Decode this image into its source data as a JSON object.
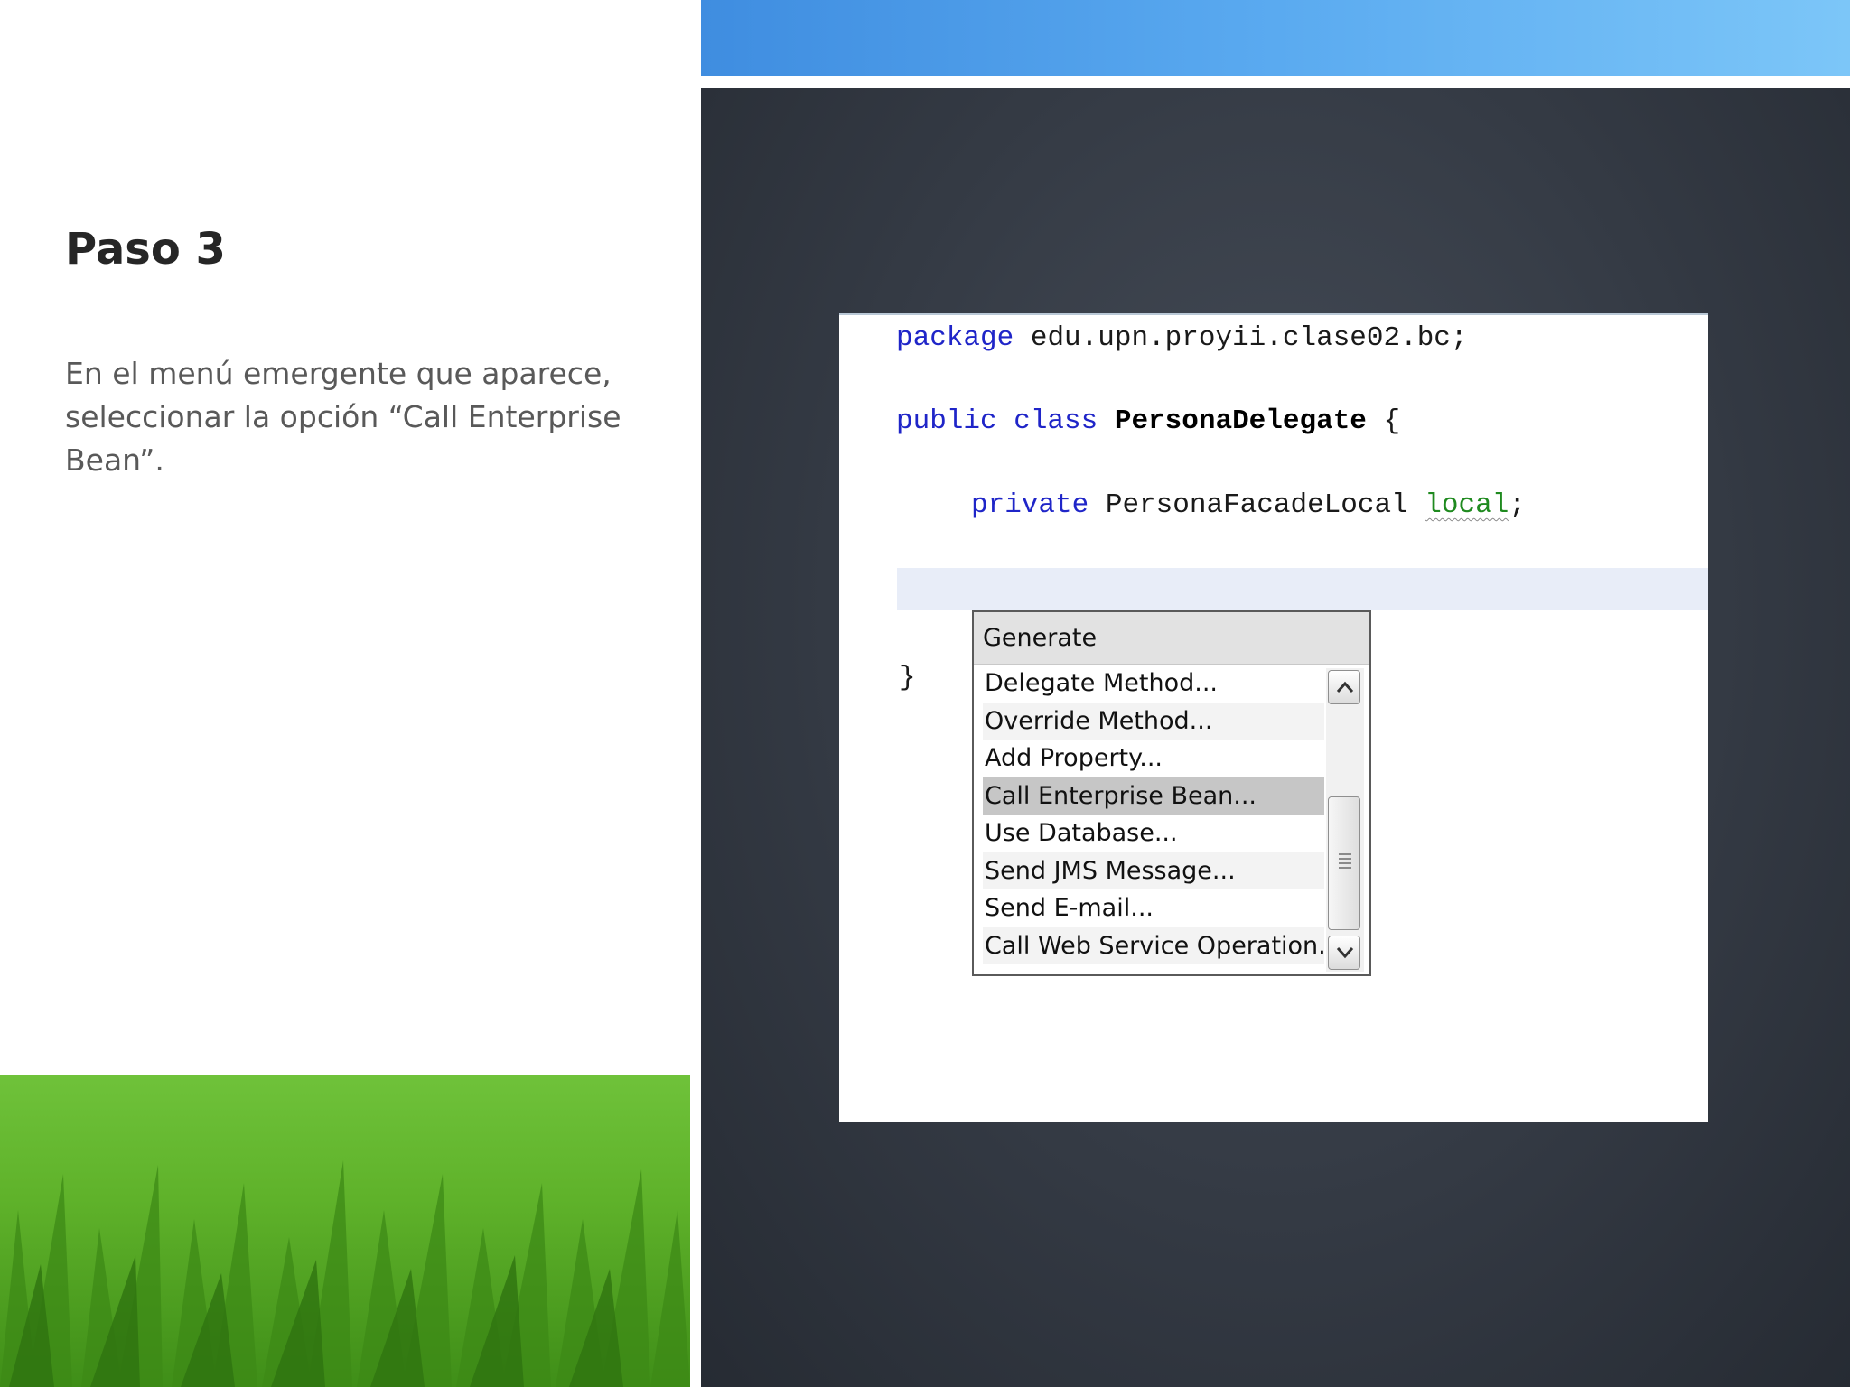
{
  "slide": {
    "title": "Paso 3",
    "body": "En el menú emergente que aparece, seleccionar la opción “Call Enterprise Bean”."
  },
  "code": {
    "line1": {
      "keyword": "package",
      "rest": " edu.upn.proyii.clase02.bc;"
    },
    "line2": {
      "kw1": "public",
      "kw2": " class",
      "classname": " PersonaDelegate",
      "rest": " {"
    },
    "line3": {
      "keyword": "private",
      "type": " PersonaFacadeLocal ",
      "field": "local",
      "end": ";"
    },
    "closing_brace": "}"
  },
  "popup": {
    "header": "Generate",
    "items": [
      "Delegate Method...",
      "Override Method...",
      "Add Property...",
      "Call Enterprise Bean...",
      "Use Database...",
      "Send JMS Message...",
      "Send E-mail...",
      "Call Web Service Operation..."
    ],
    "selected_item": "Call Enterprise Bean..."
  },
  "icons": {
    "scroll_up": "chevron-up-icon",
    "scroll_down": "chevron-down-icon",
    "scroll_grip": "grip-icon"
  },
  "colors": {
    "keyword": "#1f25c8",
    "field": "#1f8a1f",
    "selection": "#c6c6c6",
    "accent_bar": "#5aaaf0",
    "grass": "#5fb22a"
  }
}
